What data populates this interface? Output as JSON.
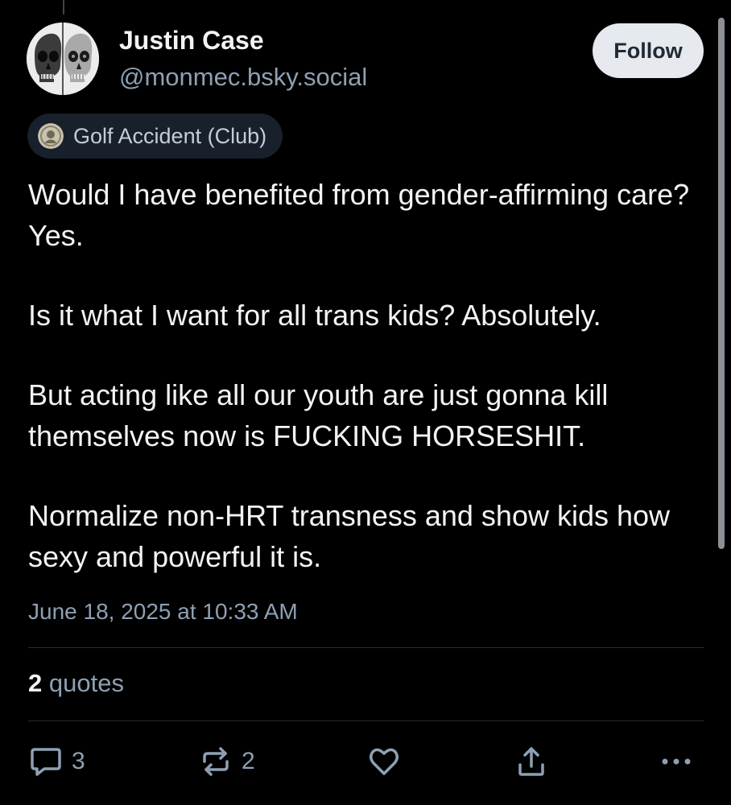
{
  "post": {
    "author": {
      "display_name": "Justin Case",
      "handle": "@monmec.bsky.social",
      "avatar_icon": "skull-avatar-icon"
    },
    "follow_label": "Follow",
    "community": {
      "label": "Golf Accident (Club)",
      "icon": "coin-icon"
    },
    "paragraphs": [
      "Would I have benefited from gender-affirming care? Yes.",
      "Is it what I want for all trans kids? Absolutely.",
      "But acting like all our youth are just gonna kill themselves now is FUCKING HORSESHIT.",
      "Normalize non-HRT transness and show kids how sexy and powerful it is."
    ],
    "timestamp": "June 18, 2025 at 10:33 AM",
    "quotes": {
      "count": "2",
      "label": "quotes"
    },
    "actions": {
      "reply": {
        "icon": "reply-icon",
        "count": "3"
      },
      "repost": {
        "icon": "repost-icon",
        "count": "2"
      },
      "like": {
        "icon": "heart-icon"
      },
      "share": {
        "icon": "share-icon"
      },
      "more": {
        "icon": "more-icon"
      }
    }
  },
  "colors": {
    "background": "#000000",
    "text_primary": "#f1f3f5",
    "text_secondary": "#8ea0b3",
    "follow_button": "#e6e9ed",
    "pill_background": "#18202b",
    "divider": "#262d36"
  }
}
